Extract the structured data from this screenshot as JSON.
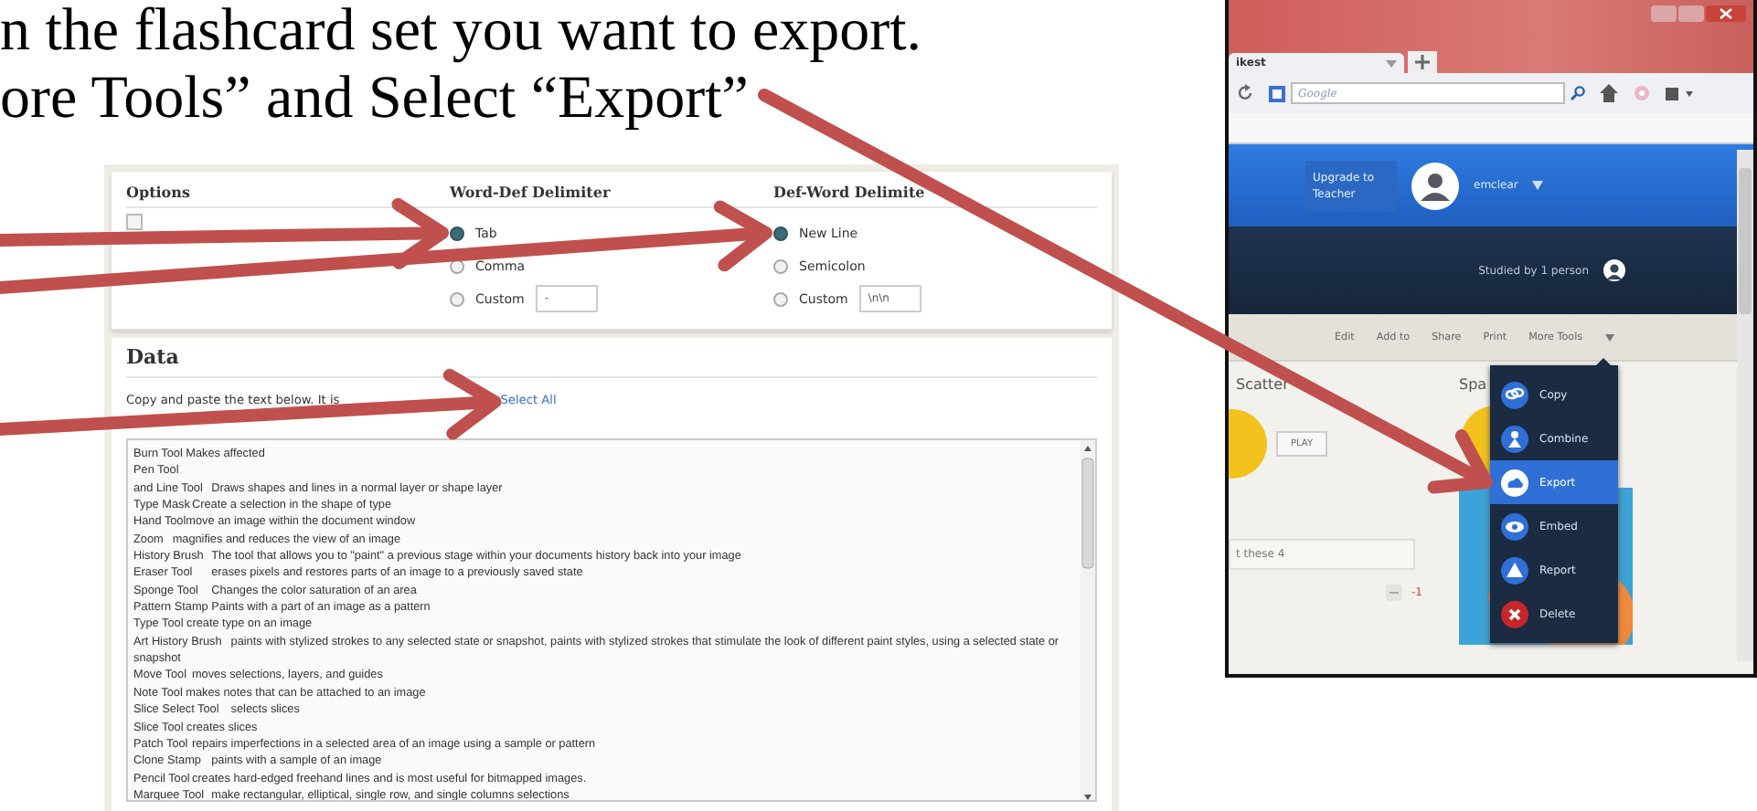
{
  "document_lines": [
    "n the flashcard set you want to export.",
    "ore Tools” and Select “Export”"
  ],
  "export_panel": {
    "options": {
      "heading": "Options",
      "checked": false
    },
    "groups": [
      {
        "heading": "Word-Def Delimiter",
        "choices": [
          {
            "label": "Tab",
            "selected": true
          },
          {
            "label": "Comma",
            "selected": false
          },
          {
            "label": "Custom",
            "selected": false,
            "value": "-"
          }
        ]
      },
      {
        "heading": "Def-Word Delimite",
        "choices": [
          {
            "label": "New Line",
            "selected": true
          },
          {
            "label": "Semicolon",
            "selected": false
          },
          {
            "label": "Custom",
            "selected": false,
            "value": "\\n\\n"
          }
        ]
      }
    ],
    "data": {
      "heading": "Data",
      "description": "Copy and paste the text below. It is",
      "link": "Select All",
      "lines": [
        "Burn Tool Makes affected",
        "Pen Tool",
        "and Line Tool\tDraws shapes and lines in a normal layer or shape layer",
        "Type Mask\tCreate a selection in the shape of type",
        "Hand Toolmove an image within the document window",
        "Zoom\tmagnifies and reduces the view of an image",
        "History Brush\tThe tool that allows you to \"paint\" a previous stage within your documents history back into your image",
        "Eraser Tool\terases pixels and restores parts of an image to a previously saved state",
        "Sponge Tool\tChanges the color saturation of an area",
        "Pattern Stamp\tPaints with a part of an image as a pattern",
        "Type Tool create type on an image",
        "Art History Brush\tpaints with stylized strokes to any selected state or snapshot, paints with stylized strokes that stimulate the look of different paint styles, using a selected state or snapshot",
        "Move Tool\tmoves selections, layers, and guides",
        "Note Tool makes notes that can be attached to an image",
        "Slice Select Tool\tselects slices",
        "Slice Tool creates slices",
        "Patch Tool\trepairs imperfections in a selected area of an image using a sample or pattern",
        "Clone Stamp\tpaints with a sample of an image",
        "Pencil Tool\tcreates hard-edged freehand lines and is most useful for bitmapped images.",
        "Marquee Tool\tmake rectangular, elliptical, single row, and single columns selections"
      ]
    }
  },
  "site_panel": {
    "tab": "ikest",
    "search": {
      "placeholder": "Google"
    },
    "upgrade_button": "Upgrade to Teacher",
    "username": "emclear",
    "studied": "Studied by 1 person",
    "toolbar": [
      "Edit",
      "Add to",
      "Share",
      "Print",
      "More Tools"
    ],
    "cards": {
      "left_title": "Scatter",
      "play": "PLAY",
      "right_title": "Spa",
      "filter": "t these 4",
      "score": "-1"
    },
    "menu": [
      {
        "kind": "copy",
        "label": "Copy",
        "selected": false
      },
      {
        "kind": "combine",
        "label": "Combine",
        "selected": false
      },
      {
        "kind": "export",
        "label": "Export",
        "selected": true
      },
      {
        "kind": "embed",
        "label": "Embed",
        "selected": false
      },
      {
        "kind": "report",
        "label": "Report",
        "selected": false
      },
      {
        "kind": "delete",
        "label": "Delete",
        "selected": false
      }
    ]
  }
}
